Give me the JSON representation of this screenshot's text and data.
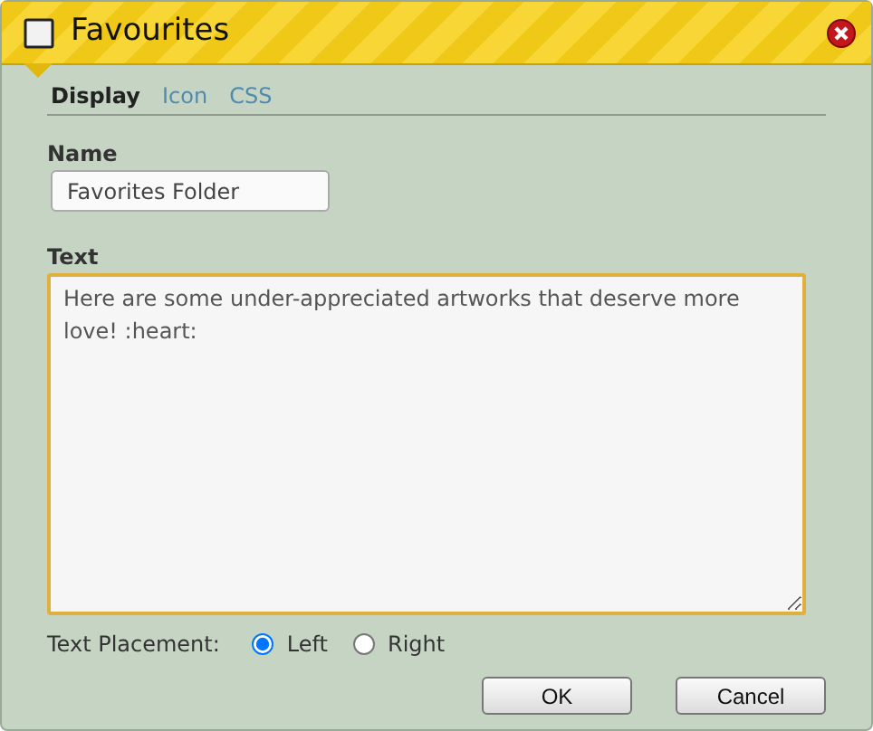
{
  "window": {
    "title": "Favourites"
  },
  "tabs": [
    {
      "label": "Display",
      "selected": true
    },
    {
      "label": "Icon",
      "selected": false
    },
    {
      "label": "CSS",
      "selected": false
    }
  ],
  "name_field": {
    "label": "Name",
    "value": "Favorites Folder"
  },
  "text_field": {
    "label": "Text",
    "value": "Here are some under-appreciated artworks that deserve more love! :heart:"
  },
  "text_placement": {
    "label": "Text Placement:",
    "options": [
      {
        "label": "Left",
        "selected": true
      },
      {
        "label": "Right",
        "selected": false
      }
    ]
  },
  "buttons": [
    {
      "label": "OK"
    },
    {
      "label": "Cancel"
    }
  ]
}
